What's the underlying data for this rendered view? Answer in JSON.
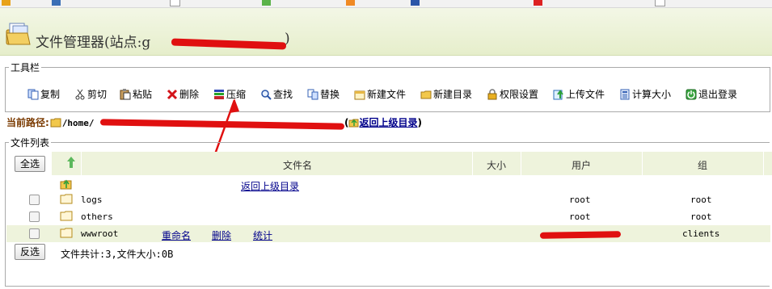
{
  "colors": {
    "accent_link": "#00008b",
    "header_bg": "#e6eecb",
    "row_alt": "#eef3dc",
    "annotation_red": "#e01010"
  },
  "app": {
    "title": "文件管理器(站点:g"
  },
  "toolbar": {
    "legend": "工具栏",
    "buttons": [
      {
        "label": "复制",
        "icon": "copy-icon"
      },
      {
        "label": "剪切",
        "icon": "scissors-icon"
      },
      {
        "label": "粘贴",
        "icon": "paste-icon"
      },
      {
        "label": "删除",
        "icon": "delete-x-icon"
      },
      {
        "label": "压缩",
        "icon": "archive-icon"
      },
      {
        "label": "查找",
        "icon": "magnifier-icon"
      },
      {
        "label": "替换",
        "icon": "replace-icon"
      },
      {
        "label": "新建文件",
        "icon": "new-file-icon"
      },
      {
        "label": "新建目录",
        "icon": "new-folder-icon"
      },
      {
        "label": "权限设置",
        "icon": "lock-icon"
      },
      {
        "label": "上传文件",
        "icon": "upload-icon"
      },
      {
        "label": "计算大小",
        "icon": "calculator-icon"
      },
      {
        "label": "退出登录",
        "icon": "logout-icon"
      }
    ]
  },
  "path": {
    "label": "当前路径:",
    "value": "/home/",
    "up_link": "返回上级目录"
  },
  "file_list": {
    "legend": "文件列表",
    "select_all": "全选",
    "invert": "反选",
    "columns": {
      "name": "文件名",
      "size": "大小",
      "user": "用户",
      "group": "组"
    },
    "parent_link": "返回上级目录",
    "rows": [
      {
        "name": "logs",
        "user": "root",
        "group": "root"
      },
      {
        "name": "others",
        "user": "root",
        "group": "root"
      },
      {
        "name": "wwwroot",
        "user": "",
        "group": "clients",
        "actions": {
          "rename": "重命名",
          "delete": "删除",
          "stats": "统计"
        }
      }
    ],
    "summary": "文件共计:3,文件大小:0B"
  }
}
